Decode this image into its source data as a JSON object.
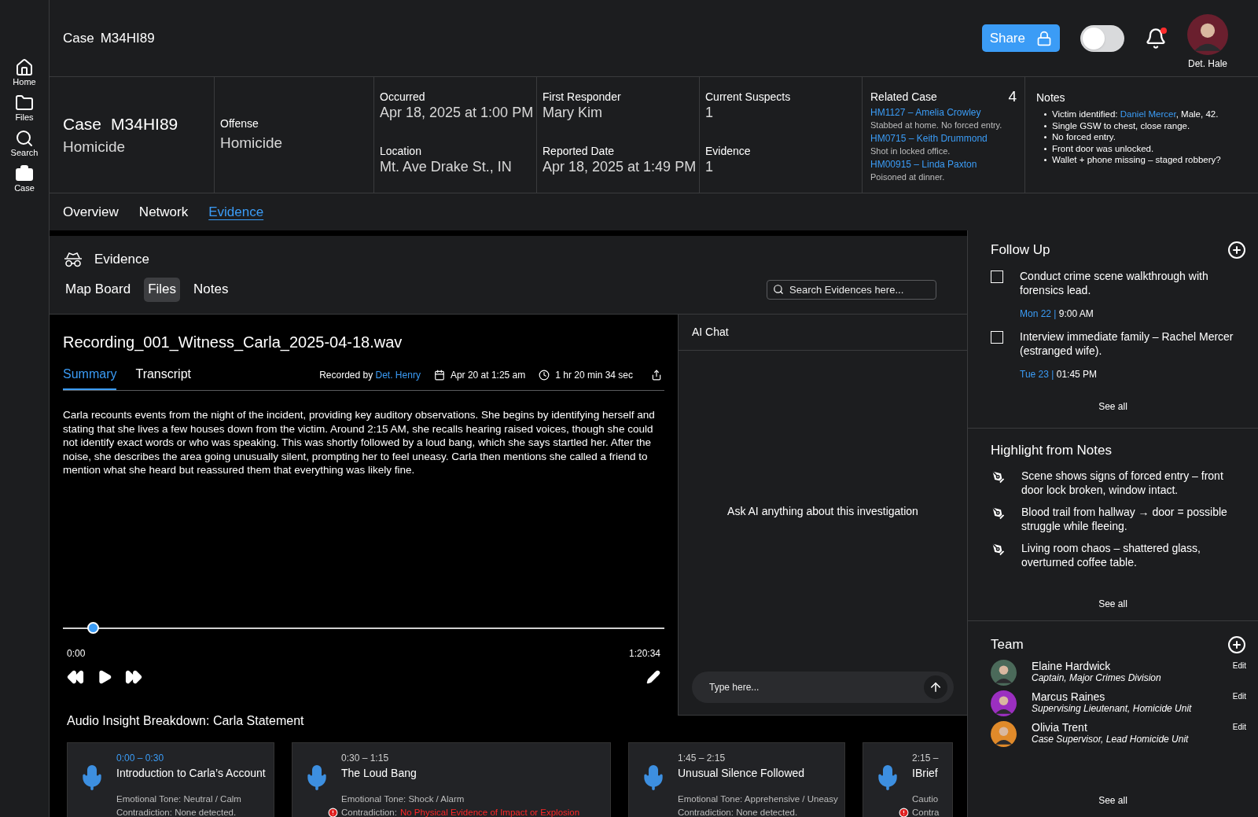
{
  "sidebar": {
    "items": [
      {
        "label": "Home",
        "kind": "home"
      },
      {
        "label": "Files",
        "kind": "files"
      },
      {
        "label": "Search",
        "kind": "search"
      },
      {
        "label": "Case",
        "kind": "case"
      }
    ]
  },
  "header": {
    "title_label": "Case",
    "title_id": "M34HI89",
    "share_button": "Share",
    "dark_mode_toggle": {
      "on": false
    },
    "notifications": {
      "unread": true
    },
    "user": {
      "name": "Det. Hale"
    }
  },
  "case_info": {
    "case_label": "Case",
    "case_id": "M34HI89",
    "case_type": "Homicide",
    "offense": {
      "label": "Offense",
      "value": "Homicide"
    },
    "field_columns": [
      [
        {
          "label": "Occurred",
          "value": "Apr 18, 2025 at 1:00 PM"
        },
        {
          "label": "Location",
          "value": "Mt. Ave Drake St., IN"
        }
      ],
      [
        {
          "label": "First Responder",
          "value": "Mary Kim"
        },
        {
          "label": "Reported Date",
          "value": "Apr 18, 2025 at 1:49 PM"
        }
      ],
      [
        {
          "label": "Current Suspects",
          "value": "1"
        },
        {
          "label": "Evidence",
          "value": "1"
        }
      ]
    ],
    "related_cases": {
      "label": "Related Case",
      "count": "4",
      "items": [
        {
          "link": "HM1127 – Amelia Crowley",
          "description": "Stabbed at home. No forced entry."
        },
        {
          "link": "HM0715 – Keith Drummond",
          "description": "Shot in locked office."
        },
        {
          "link": "HM00915 – Linda Paxton",
          "description": "Poisoned at dinner."
        }
      ]
    },
    "notes": {
      "label": "Notes",
      "items": [
        {
          "text": "Victim identified:",
          "link": "Daniel Mercer",
          "after": ", Male, 42."
        },
        {
          "text": "Single GSW to chest, close range."
        },
        {
          "text": "No forced entry."
        },
        {
          "text": "Front door was unlocked."
        },
        {
          "text": "Wallet + phone missing – staged robbery?"
        }
      ]
    }
  },
  "tabs": [
    {
      "label": "Overview",
      "selected": false
    },
    {
      "label": "Network",
      "selected": false
    },
    {
      "label": "Evidence",
      "selected": true
    }
  ],
  "evidence": {
    "title": "Evidence",
    "subtabs": [
      {
        "label": "Map Board",
        "selected": false
      },
      {
        "label": "Files",
        "selected": true
      },
      {
        "label": "Notes",
        "selected": false
      }
    ],
    "search": {
      "placeholder": "Search Evidences here..."
    }
  },
  "recording": {
    "filename": "Recording_001_Witness_Carla_2025-04-18.wav",
    "tabs": [
      {
        "label": "Summary",
        "selected": true
      },
      {
        "label": "Transcript",
        "selected": false
      }
    ],
    "recorded_by_label": "Recorded by",
    "recorded_by": "Det. Henry",
    "date": "Apr 20 at 1:25 am",
    "duration": "1 hr 20 min 34 sec",
    "summary": "Carla recounts events from the night of the incident, providing key auditory observations. She begins by identifying herself and stating that she lives a few houses down from the victim. Around 2:15 AM, she recalls hearing raised voices, though she could not identify exact words or who was speaking. This was shortly followed by a loud bang, which she says startled her. After the noise, she describes the area going unusually silent, prompting her to feel uneasy. Carla then mentions she called a friend to mention what she heard but reassured them that everything was likely fine.",
    "player": {
      "level": 0.05,
      "start": "0:00",
      "end": "1:20:34"
    }
  },
  "ai_chat": {
    "title": "AI Chat",
    "prompt": "Ask AI anything about this investigation",
    "input_placeholder": "Type here..."
  },
  "breakdown": {
    "title": "Audio Insight Breakdown: Carla Statement",
    "segments": [
      {
        "time": "0:00 – 0:30",
        "active": true,
        "title": "Introduction to Carla’s Account",
        "tone": "Emotional Tone: Neutral / Calm",
        "contradiction": "Contradiction: None detected.",
        "flagged": false
      },
      {
        "time": "0:30 – 1:15",
        "active": false,
        "title": "The Loud Bang",
        "tone": "Emotional Tone: Shock / Alarm",
        "contradiction": "Contradiction:",
        "finding": "No Physical Evidence of Impact or Explosion",
        "flagged": true
      },
      {
        "time": "1:45 – 2:15",
        "active": false,
        "title": "Unusual Silence Followed",
        "tone": "Emotional Tone: Apprehensive / Uneasy",
        "contradiction": "Contradiction: None detected.",
        "flagged": false
      },
      {
        "time": "2:15 –",
        "active": false,
        "title": "IBrief",
        "tone": "Cautio",
        "contradiction": "Contra",
        "flagged": true
      }
    ]
  },
  "follow_up": {
    "title": "Follow Up",
    "items": [
      {
        "text": "Conduct crime scene walkthrough with forensics lead.",
        "checked": false,
        "day": "Mon 22 |",
        "time": "9:00 AM"
      },
      {
        "text": "Interview immediate family – Rachel Mercer (estranged wife).",
        "checked": false,
        "day": "Tue 23 |",
        "time": "01:45 PM"
      }
    ],
    "see_all": "See all"
  },
  "highlights": {
    "title": "Highlight from Notes",
    "items": [
      "Scene shows signs of forced entry – front door lock broken, window intact.",
      "Blood trail from hallway → door = possible struggle while fleeing.",
      "Living room chaos – shattered glass, overturned coffee table."
    ],
    "see_all": "See all"
  },
  "team": {
    "title": "Team",
    "members": [
      {
        "name": "Elaine Hardwick",
        "role": "Captain, Major Crimes Division",
        "edit": "Edit",
        "color": "#4b6a5a"
      },
      {
        "name": "Marcus Raines",
        "role": "Supervising Lieutenant, Homicide Unit",
        "edit": "Edit",
        "color": "#9b2fc0"
      },
      {
        "name": "Olivia Trent",
        "role": "Case Supervisor, Lead Homicide Unit",
        "edit": "Edit",
        "color": "#e08a2a"
      }
    ],
    "see_all": "See all"
  }
}
